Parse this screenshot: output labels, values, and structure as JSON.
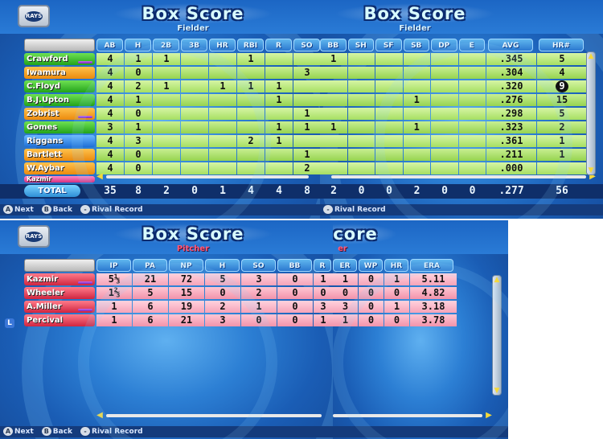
{
  "colors": {
    "grid_green": "#b7e77a",
    "grid_pink": "#f8b0c2",
    "header_blue": "#2b78cf",
    "total_bar": "#0f2f6a",
    "accent_yellow": "#f5d93a"
  },
  "team_logo_text": "RAYS",
  "fielder_left": {
    "title": "Box Score",
    "subtitle": "Fielder",
    "columns": [
      "AB",
      "H",
      "2B",
      "3B",
      "HR",
      "RBI",
      "R",
      "SO"
    ],
    "rows": [
      {
        "name": "Crawford",
        "color": "green",
        "bar": "purple",
        "vals": [
          "4",
          "1",
          "1",
          "",
          "",
          "1",
          "",
          ""
        ]
      },
      {
        "name": "Iwamura",
        "color": "orange",
        "bar": "",
        "vals": [
          "4",
          "0",
          "",
          "",
          "",
          "",
          "",
          "3"
        ]
      },
      {
        "name": "C.Floyd",
        "color": "green",
        "bar": "",
        "vals": [
          "4",
          "2",
          "1",
          "",
          "1",
          "1",
          "1",
          ""
        ]
      },
      {
        "name": "B.J.Upton",
        "color": "green",
        "bar": "",
        "vals": [
          "4",
          "1",
          "",
          "",
          "",
          "",
          "1",
          ""
        ]
      },
      {
        "name": "Zobrist",
        "color": "orange",
        "bar": "purple",
        "vals": [
          "4",
          "0",
          "",
          "",
          "",
          "",
          "",
          "1"
        ]
      },
      {
        "name": "Gomes",
        "color": "green",
        "bar": "",
        "vals": [
          "3",
          "1",
          "",
          "",
          "",
          "",
          "1",
          "1"
        ]
      },
      {
        "name": "Riggans",
        "color": "blue",
        "bar": "",
        "vals": [
          "4",
          "3",
          "",
          "",
          "",
          "2",
          "1",
          ""
        ]
      },
      {
        "name": "Bartlett",
        "color": "orange",
        "bar": "",
        "vals": [
          "4",
          "0",
          "",
          "",
          "",
          "",
          "",
          "1"
        ]
      },
      {
        "name": "W.Aybar",
        "color": "orange",
        "bar": "",
        "vals": [
          "4",
          "0",
          "",
          "",
          "",
          "",
          "",
          "2"
        ]
      }
    ],
    "partial_row": "Kazmir",
    "total_label": "TOTAL",
    "totals": [
      "35",
      "8",
      "2",
      "0",
      "1",
      "4",
      "4",
      "8"
    ],
    "footer": [
      {
        "btn": "A",
        "label": "Next"
      },
      {
        "btn": "B",
        "label": "Back"
      },
      {
        "btn": "-",
        "label": "Rival Record"
      }
    ]
  },
  "fielder_right": {
    "title": "Box Score",
    "subtitle": "Fielder",
    "columns": [
      "BB",
      "SH",
      "SF",
      "SB",
      "DP",
      "E",
      "AVG",
      "HR#"
    ],
    "rows": [
      {
        "vals": [
          "1",
          "",
          "",
          "",
          "",
          "",
          ".345",
          "5"
        ]
      },
      {
        "vals": [
          "",
          "",
          "",
          "",
          "",
          "",
          ".304",
          "4"
        ]
      },
      {
        "vals": [
          "",
          "",
          "",
          "",
          "",
          "",
          ".320",
          "9"
        ],
        "highlight": 7
      },
      {
        "vals": [
          "",
          "",
          "",
          "1",
          "",
          "",
          ".276",
          "15"
        ]
      },
      {
        "vals": [
          "",
          "",
          "",
          "",
          "",
          "",
          ".298",
          "5"
        ]
      },
      {
        "vals": [
          "1",
          "",
          "",
          "1",
          "",
          "",
          ".323",
          "2"
        ]
      },
      {
        "vals": [
          "",
          "",
          "",
          "",
          "",
          "",
          ".361",
          "1"
        ]
      },
      {
        "vals": [
          "",
          "",
          "",
          "",
          "",
          "",
          ".211",
          "1"
        ]
      },
      {
        "vals": [
          "",
          "",
          "",
          "",
          "",
          "",
          ".000",
          ""
        ]
      }
    ],
    "totals": [
      "2",
      "0",
      "0",
      "2",
      "0",
      "0",
      ".277",
      "56"
    ],
    "footer": [
      {
        "btn": "-",
        "label": "Rival Record"
      }
    ]
  },
  "pitcher_left": {
    "title": "Box Score",
    "subtitle": "Pitcher",
    "columns": [
      "IP",
      "PA",
      "NP",
      "H",
      "SO",
      "BB",
      "R"
    ],
    "rows": [
      {
        "name": "Kazmir",
        "color": "red",
        "bar": "purple",
        "vals": [
          "5⅓",
          "21",
          "72",
          "5",
          "3",
          "0",
          "1"
        ]
      },
      {
        "name": "Wheeler",
        "color": "red",
        "bar": "",
        "vals": [
          "1⅔",
          "5",
          "15",
          "0",
          "2",
          "0",
          "0"
        ]
      },
      {
        "name": "A.Miller",
        "color": "red",
        "bar": "purple",
        "vals": [
          "1",
          "6",
          "19",
          "2",
          "1",
          "0",
          "3"
        ]
      },
      {
        "name": "Percival",
        "color": "red",
        "bar": "",
        "vals": [
          "1",
          "6",
          "21",
          "3",
          "0",
          "0",
          "1"
        ]
      }
    ],
    "l_marker": "L",
    "footer": [
      {
        "btn": "A",
        "label": "Next"
      },
      {
        "btn": "B",
        "label": "Back"
      },
      {
        "btn": "-",
        "label": "Rival Record"
      }
    ]
  },
  "pitcher_right": {
    "title": "Score",
    "subtitle": "er",
    "columns": [
      "ER",
      "WP",
      "HR",
      "ERA"
    ],
    "rows": [
      {
        "vals": [
          "1",
          "0",
          "1",
          "5.11"
        ]
      },
      {
        "vals": [
          "0",
          "0",
          "0",
          "4.82"
        ]
      },
      {
        "vals": [
          "3",
          "0",
          "1",
          "3.18"
        ]
      },
      {
        "vals": [
          "1",
          "0",
          "0",
          "3.78"
        ]
      }
    ]
  }
}
